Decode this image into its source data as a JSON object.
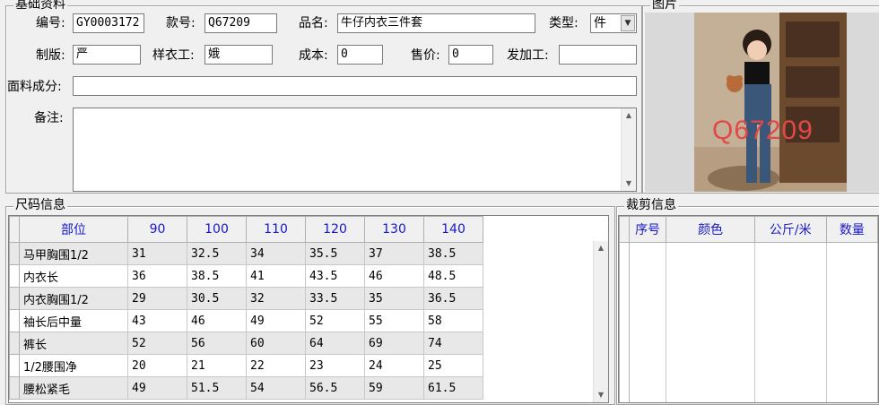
{
  "basic_info": {
    "title": "基础资料",
    "fields": {
      "code_label": "编号:",
      "code_value": "GY0003172",
      "style_label": "款号:",
      "style_value": "Q67209",
      "name_label": "品名:",
      "name_value": "牛仔内衣三件套",
      "type_label": "类型:",
      "type_value": "件",
      "pattern_label": "制版:",
      "pattern_value": "严",
      "sample_label": "样衣工:",
      "sample_value": "娥",
      "cost_label": "成本:",
      "cost_value": "0",
      "price_label": "售价:",
      "price_value": "0",
      "process_label": "发加工:",
      "process_value": "",
      "fabric_label": "面料成分:",
      "fabric_value": "",
      "remark_label": "备注:",
      "remark_value": ""
    }
  },
  "picture": {
    "title": "图片",
    "watermark": "Q67209"
  },
  "size_info": {
    "title": "尺码信息",
    "columns": [
      "部位",
      "90",
      "100",
      "110",
      "120",
      "130",
      "140"
    ],
    "rows": [
      [
        "马甲胸围1/2",
        "31",
        "32.5",
        "34",
        "35.5",
        "37",
        "38.5"
      ],
      [
        "内衣长",
        "36",
        "38.5",
        "41",
        "43.5",
        "46",
        "48.5"
      ],
      [
        "内衣胸围1/2",
        "29",
        "30.5",
        "32",
        "33.5",
        "35",
        "36.5"
      ],
      [
        "袖长后中量",
        "43",
        "46",
        "49",
        "52",
        "55",
        "58"
      ],
      [
        "裤长",
        "52",
        "56",
        "60",
        "64",
        "69",
        "74"
      ],
      [
        "1/2腰围净",
        "20",
        "21",
        "22",
        "23",
        "24",
        "25"
      ],
      [
        "腰松紧毛",
        "49",
        "51.5",
        "54",
        "56.5",
        "59",
        "61.5"
      ]
    ]
  },
  "cut_info": {
    "title": "裁剪信息",
    "columns": [
      "序号",
      "颜色",
      "公斤/米",
      "数量"
    ]
  },
  "icons": {
    "dropdown": "chevron-down-icon",
    "scroll_up": "scroll-up-arrow-icon",
    "scroll_down": "scroll-down-arrow-icon"
  }
}
